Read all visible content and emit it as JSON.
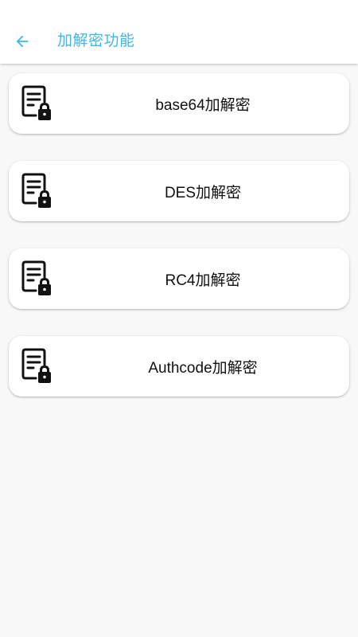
{
  "app_bar": {
    "back_icon": "arrow-left-icon",
    "title": "加解密功能",
    "accent_color": "#3fb7ea"
  },
  "items": [
    {
      "label": "base64加解密",
      "icon": "document-lock-icon"
    },
    {
      "label": "DES加解密",
      "icon": "document-lock-icon"
    },
    {
      "label": "RC4加解密",
      "icon": "document-lock-icon"
    },
    {
      "label": "Authcode加解密",
      "icon": "document-lock-icon"
    }
  ]
}
